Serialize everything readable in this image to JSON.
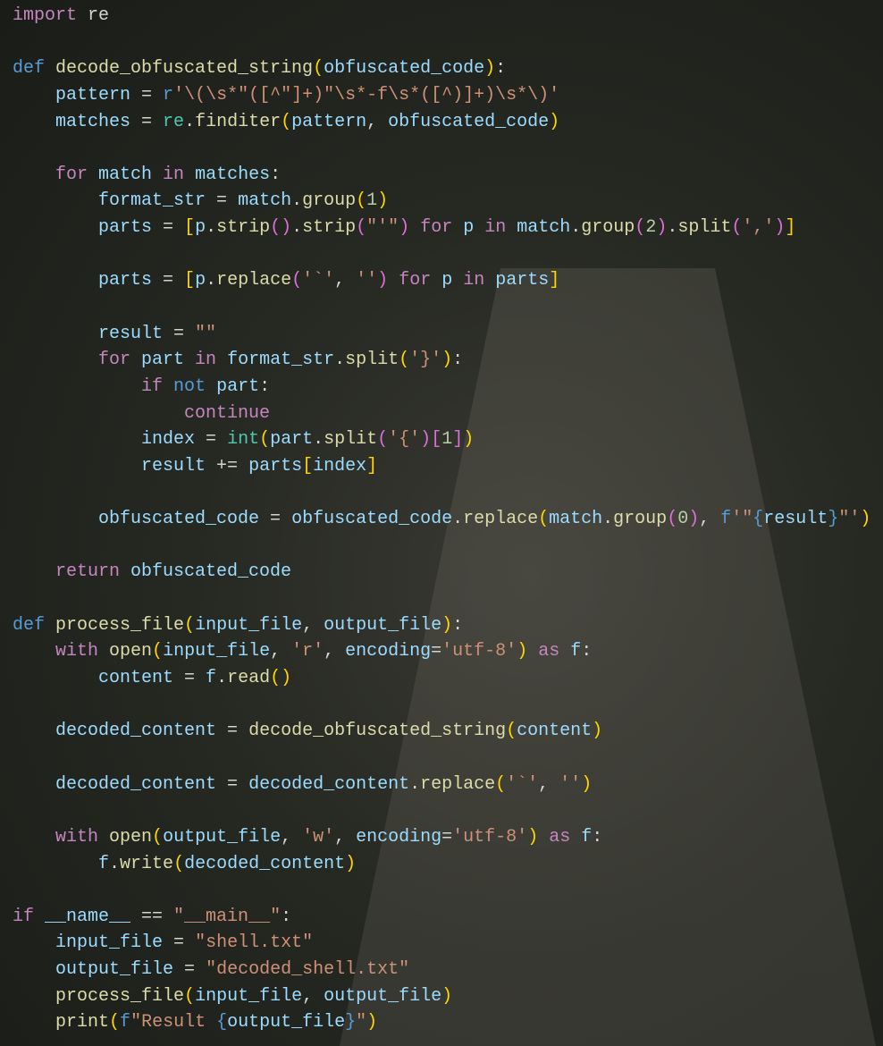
{
  "code_lines": [
    [
      [
        "c",
        "import "
      ],
      [
        "p",
        "re"
      ]
    ],
    [],
    [
      [
        "k",
        "def "
      ],
      [
        "f",
        "decode_obfuscated_string"
      ],
      [
        "b1",
        "("
      ],
      [
        "v",
        "obfuscated_code"
      ],
      [
        "b1",
        ")"
      ],
      [
        "p",
        ":"
      ]
    ],
    [
      [
        "p",
        "    "
      ],
      [
        "v",
        "pattern"
      ],
      [
        "p",
        " = "
      ],
      [
        "k",
        "r"
      ],
      [
        "s",
        "'\\(\\s*\"([^\"]+)\"\\s*-f\\s*([^)]+)\\s*\\)'"
      ]
    ],
    [
      [
        "p",
        "    "
      ],
      [
        "v",
        "matches"
      ],
      [
        "p",
        " = "
      ],
      [
        "m",
        "re"
      ],
      [
        "p",
        "."
      ],
      [
        "f",
        "finditer"
      ],
      [
        "b1",
        "("
      ],
      [
        "v",
        "pattern"
      ],
      [
        "p",
        ", "
      ],
      [
        "v",
        "obfuscated_code"
      ],
      [
        "b1",
        ")"
      ]
    ],
    [],
    [
      [
        "p",
        "    "
      ],
      [
        "c",
        "for "
      ],
      [
        "v",
        "match"
      ],
      [
        "c",
        " in "
      ],
      [
        "v",
        "matches"
      ],
      [
        "p",
        ":"
      ]
    ],
    [
      [
        "p",
        "        "
      ],
      [
        "v",
        "format_str"
      ],
      [
        "p",
        " = "
      ],
      [
        "v",
        "match"
      ],
      [
        "p",
        "."
      ],
      [
        "f",
        "group"
      ],
      [
        "b1",
        "("
      ],
      [
        "n",
        "1"
      ],
      [
        "b1",
        ")"
      ]
    ],
    [
      [
        "p",
        "        "
      ],
      [
        "v",
        "parts"
      ],
      [
        "p",
        " = "
      ],
      [
        "b1",
        "["
      ],
      [
        "v",
        "p"
      ],
      [
        "p",
        "."
      ],
      [
        "f",
        "strip"
      ],
      [
        "b2",
        "()"
      ],
      [
        "p",
        "."
      ],
      [
        "f",
        "strip"
      ],
      [
        "b2",
        "("
      ],
      [
        "s",
        "\"'\""
      ],
      [
        "b2",
        ")"
      ],
      [
        "c",
        " for "
      ],
      [
        "v",
        "p"
      ],
      [
        "c",
        " in "
      ],
      [
        "v",
        "match"
      ],
      [
        "p",
        "."
      ],
      [
        "f",
        "group"
      ],
      [
        "b2",
        "("
      ],
      [
        "n",
        "2"
      ],
      [
        "b2",
        ")"
      ],
      [
        "p",
        "."
      ],
      [
        "f",
        "split"
      ],
      [
        "b2",
        "("
      ],
      [
        "s",
        "','"
      ],
      [
        "b2",
        ")"
      ],
      [
        "b1",
        "]"
      ]
    ],
    [],
    [
      [
        "p",
        "        "
      ],
      [
        "v",
        "parts"
      ],
      [
        "p",
        " = "
      ],
      [
        "b1",
        "["
      ],
      [
        "v",
        "p"
      ],
      [
        "p",
        "."
      ],
      [
        "f",
        "replace"
      ],
      [
        "b2",
        "("
      ],
      [
        "s",
        "'`'"
      ],
      [
        "p",
        ", "
      ],
      [
        "s",
        "''"
      ],
      [
        "b2",
        ")"
      ],
      [
        "c",
        " for "
      ],
      [
        "v",
        "p"
      ],
      [
        "c",
        " in "
      ],
      [
        "v",
        "parts"
      ],
      [
        "b1",
        "]"
      ]
    ],
    [],
    [
      [
        "p",
        "        "
      ],
      [
        "v",
        "result"
      ],
      [
        "p",
        " = "
      ],
      [
        "s",
        "\"\""
      ]
    ],
    [
      [
        "p",
        "        "
      ],
      [
        "c",
        "for "
      ],
      [
        "v",
        "part"
      ],
      [
        "c",
        " in "
      ],
      [
        "v",
        "format_str"
      ],
      [
        "p",
        "."
      ],
      [
        "f",
        "split"
      ],
      [
        "b1",
        "("
      ],
      [
        "s",
        "'}'"
      ],
      [
        "b1",
        ")"
      ],
      [
        "p",
        ":"
      ]
    ],
    [
      [
        "p",
        "            "
      ],
      [
        "c",
        "if "
      ],
      [
        "k",
        "not "
      ],
      [
        "v",
        "part"
      ],
      [
        "p",
        ":"
      ]
    ],
    [
      [
        "p",
        "                "
      ],
      [
        "c",
        "continue"
      ]
    ],
    [
      [
        "p",
        "            "
      ],
      [
        "v",
        "index"
      ],
      [
        "p",
        " = "
      ],
      [
        "m",
        "int"
      ],
      [
        "b1",
        "("
      ],
      [
        "v",
        "part"
      ],
      [
        "p",
        "."
      ],
      [
        "f",
        "split"
      ],
      [
        "b2",
        "("
      ],
      [
        "s",
        "'{'"
      ],
      [
        "b2",
        ")"
      ],
      [
        "b2",
        "["
      ],
      [
        "n",
        "1"
      ],
      [
        "b2",
        "]"
      ],
      [
        "b1",
        ")"
      ]
    ],
    [
      [
        "p",
        "            "
      ],
      [
        "v",
        "result"
      ],
      [
        "p",
        " += "
      ],
      [
        "v",
        "parts"
      ],
      [
        "b1",
        "["
      ],
      [
        "v",
        "index"
      ],
      [
        "b1",
        "]"
      ]
    ],
    [],
    [
      [
        "p",
        "        "
      ],
      [
        "v",
        "obfuscated_code"
      ],
      [
        "p",
        " = "
      ],
      [
        "v",
        "obfuscated_code"
      ],
      [
        "p",
        "."
      ],
      [
        "f",
        "replace"
      ],
      [
        "b1",
        "("
      ],
      [
        "v",
        "match"
      ],
      [
        "p",
        "."
      ],
      [
        "f",
        "group"
      ],
      [
        "b2",
        "("
      ],
      [
        "n",
        "0"
      ],
      [
        "b2",
        ")"
      ],
      [
        "p",
        ", "
      ],
      [
        "k",
        "f"
      ],
      [
        "s",
        "'\""
      ],
      [
        "k",
        "{"
      ],
      [
        "v",
        "result"
      ],
      [
        "k",
        "}"
      ],
      [
        "s",
        "\"'"
      ],
      [
        "b1",
        ")"
      ]
    ],
    [],
    [
      [
        "p",
        "    "
      ],
      [
        "c",
        "return "
      ],
      [
        "v",
        "obfuscated_code"
      ]
    ],
    [],
    [
      [
        "k",
        "def "
      ],
      [
        "f",
        "process_file"
      ],
      [
        "b1",
        "("
      ],
      [
        "v",
        "input_file"
      ],
      [
        "p",
        ", "
      ],
      [
        "v",
        "output_file"
      ],
      [
        "b1",
        ")"
      ],
      [
        "p",
        ":"
      ]
    ],
    [
      [
        "p",
        "    "
      ],
      [
        "c",
        "with "
      ],
      [
        "f",
        "open"
      ],
      [
        "b1",
        "("
      ],
      [
        "v",
        "input_file"
      ],
      [
        "p",
        ", "
      ],
      [
        "s",
        "'r'"
      ],
      [
        "p",
        ", "
      ],
      [
        "v",
        "encoding"
      ],
      [
        "p",
        "="
      ],
      [
        "s",
        "'utf-8'"
      ],
      [
        "b1",
        ")"
      ],
      [
        "c",
        " as "
      ],
      [
        "v",
        "f"
      ],
      [
        "p",
        ":"
      ]
    ],
    [
      [
        "p",
        "        "
      ],
      [
        "v",
        "content"
      ],
      [
        "p",
        " = "
      ],
      [
        "v",
        "f"
      ],
      [
        "p",
        "."
      ],
      [
        "f",
        "read"
      ],
      [
        "b1",
        "()"
      ]
    ],
    [],
    [
      [
        "p",
        "    "
      ],
      [
        "v",
        "decoded_content"
      ],
      [
        "p",
        " = "
      ],
      [
        "f",
        "decode_obfuscated_string"
      ],
      [
        "b1",
        "("
      ],
      [
        "v",
        "content"
      ],
      [
        "b1",
        ")"
      ]
    ],
    [],
    [
      [
        "p",
        "    "
      ],
      [
        "v",
        "decoded_content"
      ],
      [
        "p",
        " = "
      ],
      [
        "v",
        "decoded_content"
      ],
      [
        "p",
        "."
      ],
      [
        "f",
        "replace"
      ],
      [
        "b1",
        "("
      ],
      [
        "s",
        "'`'"
      ],
      [
        "p",
        ", "
      ],
      [
        "s",
        "''"
      ],
      [
        "b1",
        ")"
      ]
    ],
    [],
    [
      [
        "p",
        "    "
      ],
      [
        "c",
        "with "
      ],
      [
        "f",
        "open"
      ],
      [
        "b1",
        "("
      ],
      [
        "v",
        "output_file"
      ],
      [
        "p",
        ", "
      ],
      [
        "s",
        "'w'"
      ],
      [
        "p",
        ", "
      ],
      [
        "v",
        "encoding"
      ],
      [
        "p",
        "="
      ],
      [
        "s",
        "'utf-8'"
      ],
      [
        "b1",
        ")"
      ],
      [
        "c",
        " as "
      ],
      [
        "v",
        "f"
      ],
      [
        "p",
        ":"
      ]
    ],
    [
      [
        "p",
        "        "
      ],
      [
        "v",
        "f"
      ],
      [
        "p",
        "."
      ],
      [
        "f",
        "write"
      ],
      [
        "b1",
        "("
      ],
      [
        "v",
        "decoded_content"
      ],
      [
        "b1",
        ")"
      ]
    ],
    [],
    [
      [
        "c",
        "if "
      ],
      [
        "v",
        "__name__"
      ],
      [
        "p",
        " == "
      ],
      [
        "s",
        "\"__main__\""
      ],
      [
        "p",
        ":"
      ]
    ],
    [
      [
        "p",
        "    "
      ],
      [
        "v",
        "input_file"
      ],
      [
        "p",
        " = "
      ],
      [
        "s",
        "\"shell.txt\""
      ]
    ],
    [
      [
        "p",
        "    "
      ],
      [
        "v",
        "output_file"
      ],
      [
        "p",
        " = "
      ],
      [
        "s",
        "\"decoded_shell.txt\""
      ]
    ],
    [
      [
        "p",
        "    "
      ],
      [
        "f",
        "process_file"
      ],
      [
        "b1",
        "("
      ],
      [
        "v",
        "input_file"
      ],
      [
        "p",
        ", "
      ],
      [
        "v",
        "output_file"
      ],
      [
        "b1",
        ")"
      ]
    ],
    [
      [
        "p",
        "    "
      ],
      [
        "f",
        "print"
      ],
      [
        "b1",
        "("
      ],
      [
        "k",
        "f"
      ],
      [
        "s",
        "\"Result "
      ],
      [
        "k",
        "{"
      ],
      [
        "v",
        "output_file"
      ],
      [
        "k",
        "}"
      ],
      [
        "s",
        "\""
      ],
      [
        "b1",
        ")"
      ]
    ]
  ]
}
